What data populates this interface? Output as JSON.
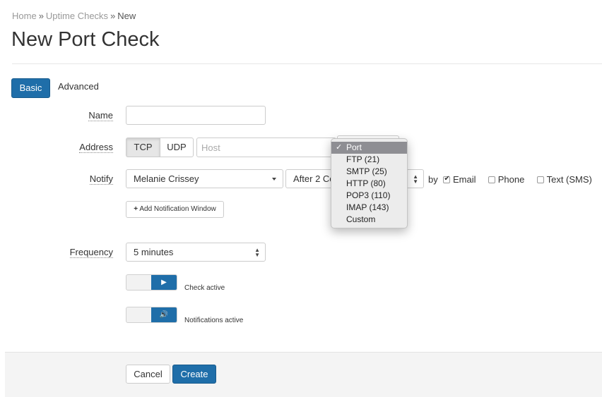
{
  "breadcrumb": {
    "items": [
      "Home",
      "Uptime Checks"
    ],
    "separator": "»",
    "current": "New"
  },
  "page_title": "New Port Check",
  "tabs": [
    {
      "label": "Basic",
      "active": true
    },
    {
      "label": "Advanced",
      "active": false
    }
  ],
  "form": {
    "name": {
      "label": "Name",
      "value": "",
      "placeholder": ""
    },
    "address": {
      "label": "Address",
      "protocols": [
        {
          "label": "TCP",
          "active": true
        },
        {
          "label": "UDP",
          "active": false
        }
      ],
      "host_placeholder": "Host",
      "port_options": [
        "Port",
        "FTP (21)",
        "SMTP (25)",
        "HTTP (80)",
        "POP3 (110)",
        "IMAP (143)",
        "Custom"
      ],
      "port_selected": "Port"
    },
    "notify": {
      "label": "Notify",
      "contact": "Melanie Crissey",
      "threshold": "After 2 Co",
      "by_label": "by",
      "channels": [
        {
          "label": "Email",
          "checked": true
        },
        {
          "label": "Phone",
          "checked": false
        },
        {
          "label": "Text (SMS)",
          "checked": false
        }
      ],
      "add_window_label": "Add Notification Window"
    },
    "frequency": {
      "label": "Frequency",
      "value": "5 minutes"
    },
    "toggles": [
      {
        "label": "Check active",
        "on": true,
        "icon": "play-icon"
      },
      {
        "label": "Notifications active",
        "on": true,
        "icon": "speaker-icon"
      }
    ]
  },
  "actions": {
    "cancel_label": "Cancel",
    "create_label": "Create"
  },
  "colors": {
    "primary": "#1f6ea9",
    "menu_highlight": "#8e8e93",
    "footer_bg": "#f4f4f4"
  }
}
